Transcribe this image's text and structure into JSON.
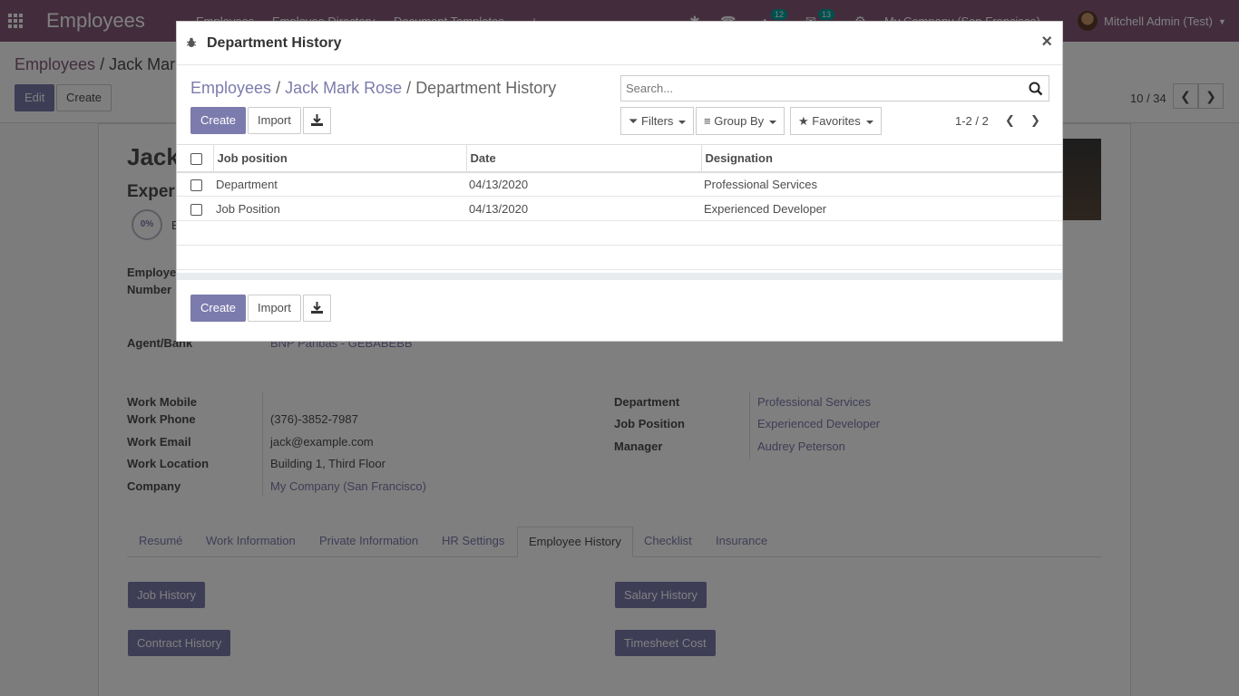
{
  "navbar": {
    "app_name": "Employees",
    "menu": [
      "Employees",
      "Employee Directory",
      "Document Templates"
    ],
    "badge_a": "12",
    "badge_b": "13",
    "company": "My Company (San Francisco)",
    "user": "Mitchell Admin (Test)"
  },
  "control_panel": {
    "breadcrumb_root": "Employees",
    "breadcrumb_sep": "/",
    "breadcrumb_current": "Jack Mar",
    "edit_label": "Edit",
    "create_label": "Create",
    "pager": "10 / 34"
  },
  "form": {
    "name_partial": "Jack",
    "job_partial": "Exper",
    "progress": "0%",
    "progress_suffix": "E",
    "employee_number_label_1": "Employe",
    "employee_number_label_2": "Number",
    "agent_bank_label": "Agent/Bank",
    "agent_bank_value": "BNP Paribas - GEBABEBB",
    "work_mobile_label": "Work Mobile",
    "work_phone_label": "Work Phone",
    "work_phone_value": "(376)-3852-7987",
    "work_email_label": "Work Email",
    "work_email_value": "jack@example.com",
    "work_location_label": "Work Location",
    "work_location_value": "Building 1, Third Floor",
    "company_label": "Company",
    "company_value": "My Company (San Francisco)",
    "department_label": "Department",
    "department_value": "Professional Services",
    "job_position_label": "Job Position",
    "job_position_value": "Experienced Developer",
    "manager_label": "Manager",
    "manager_value": "Audrey Peterson",
    "tabs": [
      "Resumé",
      "Work Information",
      "Private Information",
      "HR Settings",
      "Employee History",
      "Checklist",
      "Insurance"
    ],
    "job_history": "Job History",
    "salary_history": "Salary History",
    "contract_history": "Contract History",
    "timesheet_cost": "Timesheet Cost"
  },
  "modal": {
    "title": "Department History",
    "close": "×",
    "breadcrumb": [
      "Employees",
      "Jack Mark Rose",
      "Department History"
    ],
    "breadcrumb_sep": "/",
    "search_placeholder": "Search...",
    "create_label": "Create",
    "import_label": "Import",
    "filters_label": "Filters",
    "groupby_label": "Group By",
    "favorites_label": "Favorites",
    "pager": "1-2 / 2",
    "columns": [
      "Job position",
      "Date",
      "Designation"
    ],
    "rows": [
      {
        "job_position": "Department",
        "date": "04/13/2020",
        "designation": "Professional Services"
      },
      {
        "job_position": "Job Position",
        "date": "04/13/2020",
        "designation": "Experienced Developer"
      }
    ]
  },
  "colors": {
    "navbar": "#875a7b",
    "primary": "#7c7bad",
    "badge": "#00a09d"
  }
}
